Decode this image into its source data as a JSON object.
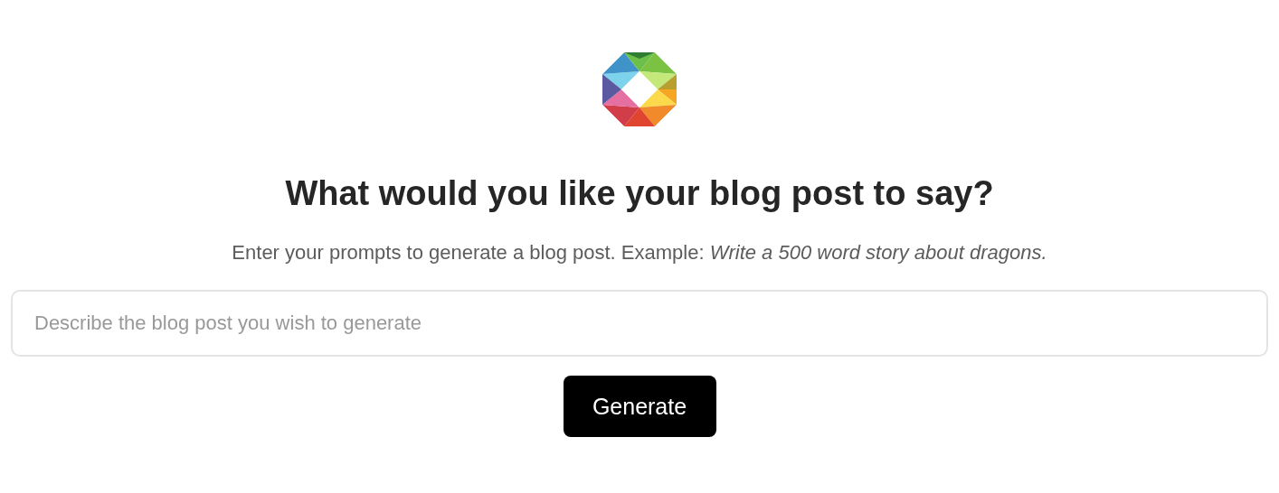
{
  "heading": "What would you like your blog post to say?",
  "subtitle": "Enter your prompts to generate a blog post. Example: *Write a 500 word story about dragons.*",
  "prompt_field": {
    "placeholder": "Describe the blog post you wish to generate"
  },
  "button": {
    "label": "Generate"
  }
}
